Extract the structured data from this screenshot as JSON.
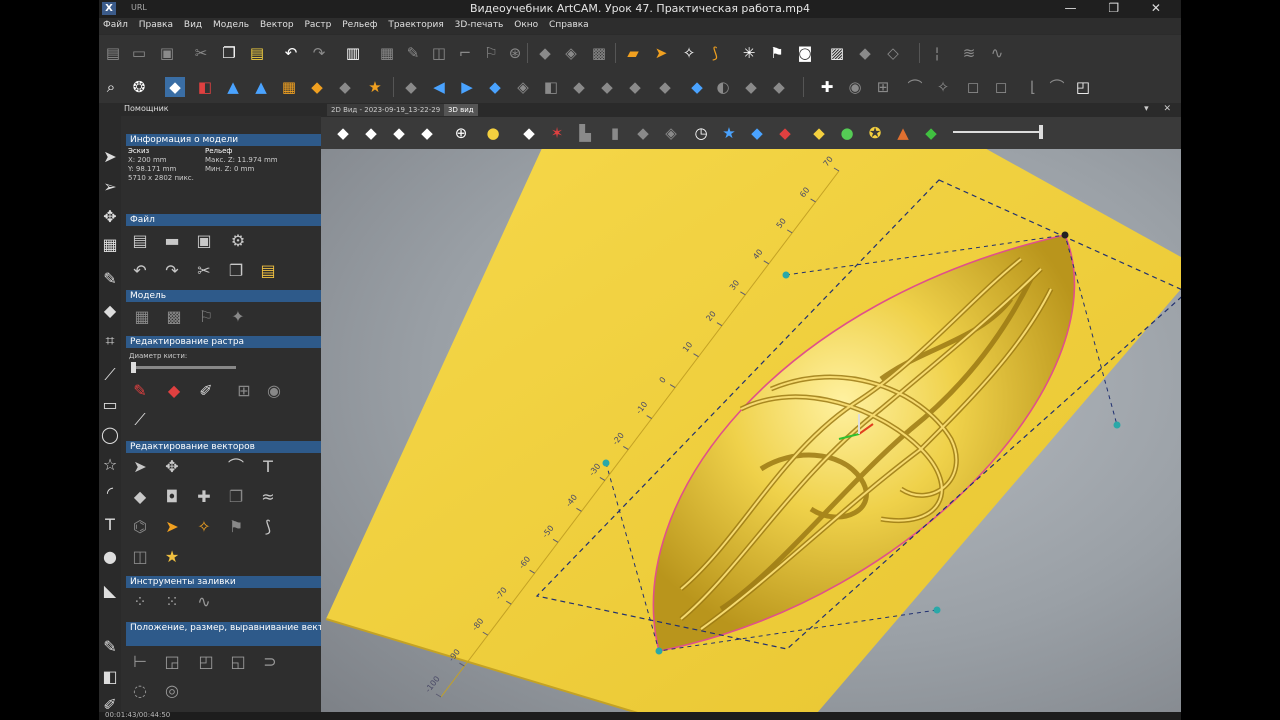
{
  "window": {
    "title": "Видеоучебник ArtCAM. Урок 47. Практическая работа.mp4",
    "small": "URL",
    "controls": "— ❐ ✕"
  },
  "menu": [
    "Файл",
    "Правка",
    "Вид",
    "Модель",
    "Вектор",
    "Растр",
    "Рельеф",
    "Траектория",
    "3D-печать",
    "Окно",
    "Справка"
  ],
  "panel": {
    "title": "Помощник",
    "header_controls": "? ▴ ✕",
    "sections": {
      "model_info": "Информация о модели",
      "file": "Файл",
      "model": "Модель",
      "raster": "Редактирование растра",
      "vectors": "Редактирование векторов",
      "fill": "Инструменты заливки",
      "position": "Положение, размер, выравнивание векторов"
    },
    "info": {
      "col1_head": "Эскиз",
      "col2_head": "Рельеф",
      "x": "X: 200 mm",
      "y": "Y: 98.171 mm",
      "px": "5710 x 2802 пикс.",
      "maxz": "Макс. Z: 11.974 mm",
      "minz": "Мин. Z: 0 mm"
    },
    "brush_label": "Диаметр кисти:"
  },
  "tabs": {
    "tab1": "2D Вид - 2023-09-19_13-22-29",
    "tab2": "3D вид",
    "controls": "▾ ✕"
  },
  "status": "00:01:43/00:44:50",
  "ruler_labels": [
    "70",
    "60",
    "50",
    "40",
    "30",
    "20",
    "10",
    "0",
    "-10",
    "-20",
    "-30",
    "-40",
    "-50",
    "-60",
    "-70",
    "-80",
    "-90",
    "-100"
  ],
  "colors": {
    "panel_section": "#2e5a8a",
    "relief": "#e6c43a",
    "plate": "#f0d040",
    "vector": "#e0508a",
    "dash": "#203070"
  }
}
